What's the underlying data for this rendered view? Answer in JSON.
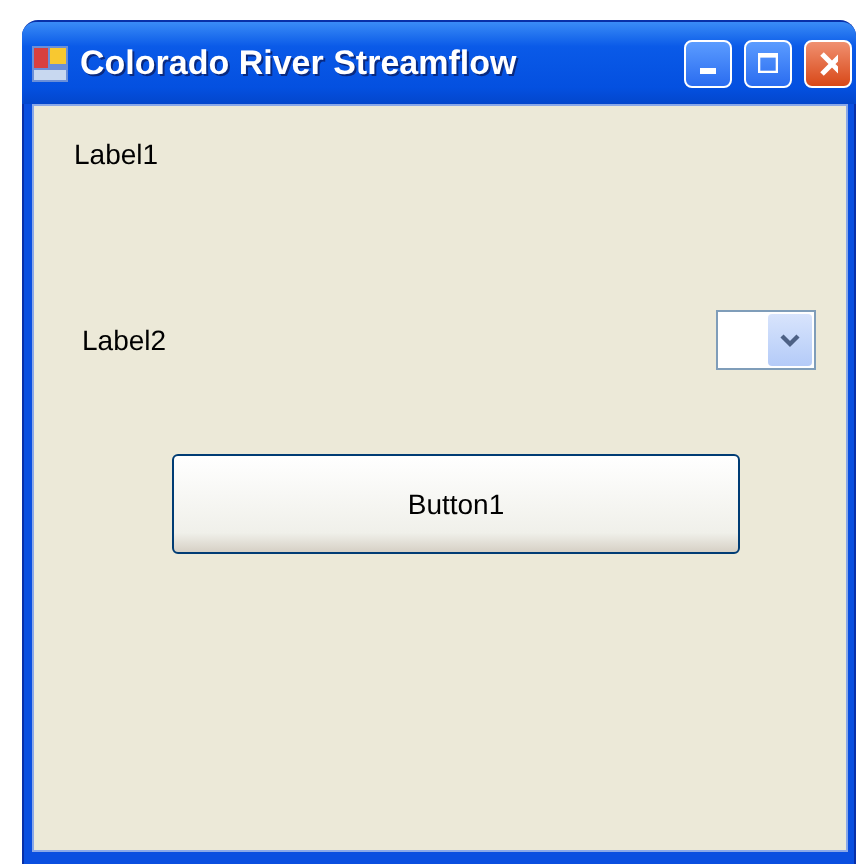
{
  "window": {
    "title": "Colorado River Streamflow"
  },
  "labels": [
    "Label1",
    "Label2"
  ],
  "button": {
    "label": "Button1"
  }
}
